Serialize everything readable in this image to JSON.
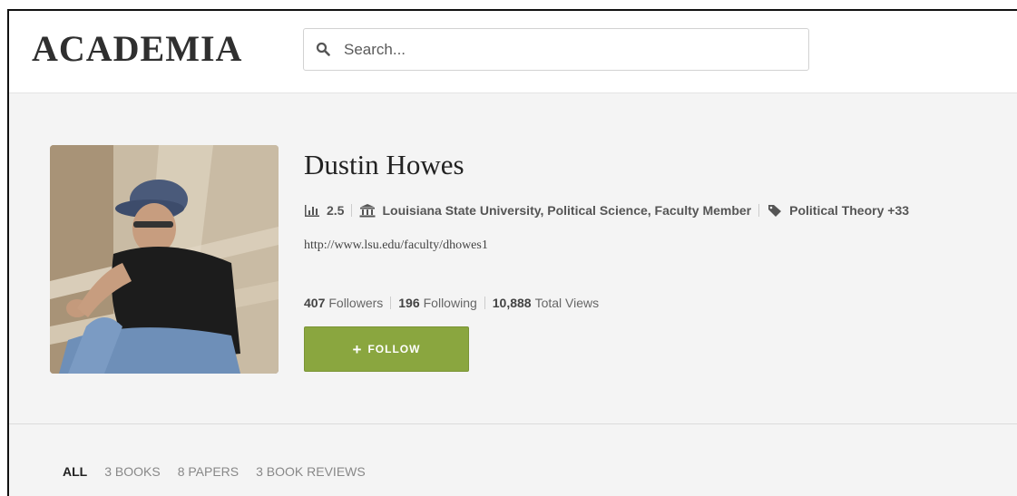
{
  "header": {
    "logo": "ACADEMIA",
    "search_placeholder": "Search..."
  },
  "profile": {
    "name": "Dustin Howes",
    "score": "2.5",
    "affiliation": "Louisiana State University, Political Science, Faculty Member",
    "research_interest": "Political Theory +33",
    "website": "http://www.lsu.edu/faculty/dhowes1",
    "stats": {
      "followers_count": "407",
      "followers_label": "Followers",
      "following_count": "196",
      "following_label": "Following",
      "views_count": "10,888",
      "views_label": "Total Views"
    },
    "follow_button": {
      "plus": "+",
      "label": "FOLLOW",
      "color": "#8aa63f"
    }
  },
  "tabs": [
    {
      "label": "ALL",
      "active": true
    },
    {
      "label": "3 BOOKS",
      "active": false
    },
    {
      "label": "8 PAPERS",
      "active": false
    },
    {
      "label": "3 BOOK REVIEWS",
      "active": false
    }
  ],
  "icons": {
    "score": "bar-chart-icon",
    "affiliation": "institution-icon",
    "interest": "tag-icon",
    "search": "search-icon"
  }
}
